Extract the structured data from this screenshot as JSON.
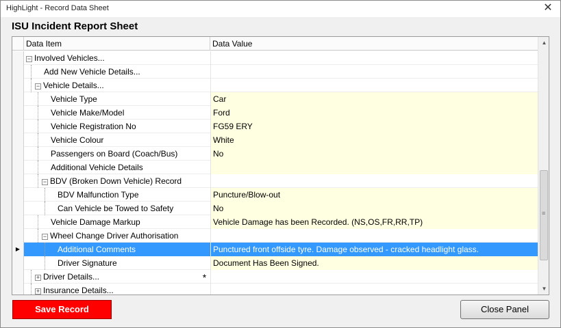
{
  "window": {
    "title": "HighLight - Record Data Sheet",
    "close_glyph": "✕"
  },
  "page_title": "ISU Incident Report Sheet",
  "grid": {
    "col_item": "Data Item",
    "col_value": "Data Value",
    "rows": [
      {
        "label": "Involved Vehicles...",
        "value": "",
        "level": 0,
        "toggle": "−",
        "filled": false
      },
      {
        "label": "Add New Vehicle Details...",
        "value": "",
        "level": 1,
        "toggle": "",
        "filled": false
      },
      {
        "label": "Vehicle Details...",
        "value": "",
        "level": 1,
        "toggle": "−",
        "filled": false
      },
      {
        "label": "Vehicle Type",
        "value": "Car",
        "level": 2,
        "toggle": "",
        "filled": true
      },
      {
        "label": "Vehicle Make/Model",
        "value": "Ford",
        "level": 2,
        "toggle": "",
        "filled": true
      },
      {
        "label": "Vehicle Registration No",
        "value": "FG59 ERY",
        "level": 2,
        "toggle": "",
        "filled": true
      },
      {
        "label": "Vehicle Colour",
        "value": "White",
        "level": 2,
        "toggle": "",
        "filled": true
      },
      {
        "label": "Passengers on Board (Coach/Bus)",
        "value": "No",
        "level": 2,
        "toggle": "",
        "filled": true
      },
      {
        "label": "Additional Vehicle Details",
        "value": "",
        "level": 2,
        "toggle": "",
        "filled": true
      },
      {
        "label": "BDV (Broken Down Vehicle) Record",
        "value": "",
        "level": 2,
        "toggle": "−",
        "filled": false
      },
      {
        "label": "BDV Malfunction Type",
        "value": "Puncture/Blow-out",
        "level": 3,
        "toggle": "",
        "filled": true
      },
      {
        "label": "Can Vehicle be Towed to Safety",
        "value": "No",
        "level": 3,
        "toggle": "",
        "filled": true
      },
      {
        "label": "Vehicle Damage Markup",
        "value": "Vehicle Damage has been Recorded. (NS,OS,FR,RR,TP)",
        "level": 2,
        "toggle": "",
        "filled": true
      },
      {
        "label": "Wheel Change Driver Authorisation",
        "value": "",
        "level": 2,
        "toggle": "−",
        "filled": false
      },
      {
        "label": "Additional Comments",
        "value": "Punctured front offside tyre. Damage observed - cracked headlight glass.",
        "level": 3,
        "toggle": "",
        "filled": true,
        "selected": true,
        "marker": "▶"
      },
      {
        "label": "Driver Signature",
        "value": "Document Has Been Signed.",
        "level": 3,
        "toggle": "",
        "filled": true
      },
      {
        "label": "Driver Details...",
        "value": "",
        "level": 1,
        "toggle": "+",
        "filled": false,
        "mid": "*"
      },
      {
        "label": "Insurance Details...",
        "value": "",
        "level": 1,
        "toggle": "+",
        "filled": false
      }
    ]
  },
  "scrollbar": {
    "up": "▲",
    "down": "▼",
    "grip": "≡"
  },
  "buttons": {
    "save": "Save Record",
    "close": "Close Panel"
  },
  "colors": {
    "save_bg": "#ff0000",
    "selection": "#3399ff",
    "filled_cell": "#ffffe1"
  }
}
